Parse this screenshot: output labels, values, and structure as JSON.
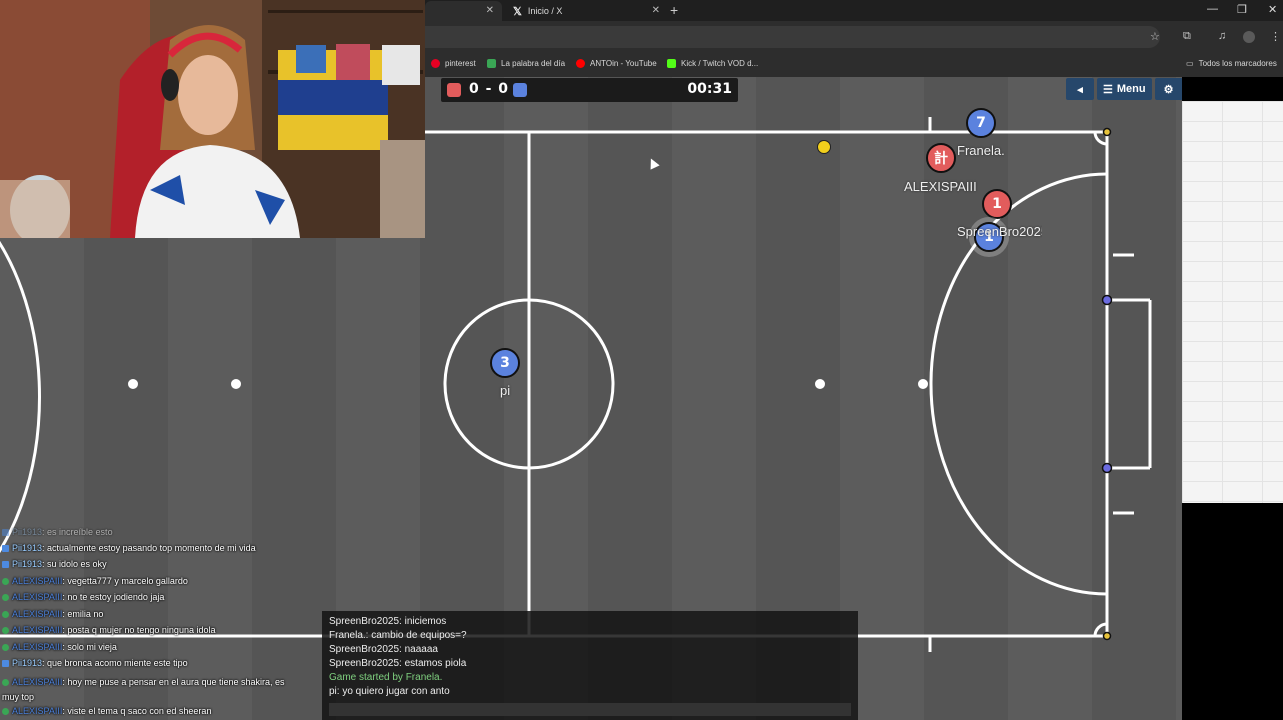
{
  "browser": {
    "tabs": [
      {
        "title": ""
      },
      {
        "title": "Inicio / X",
        "icon": "x-logo"
      }
    ],
    "new_tab": "+",
    "window_controls": {
      "minimize": "—",
      "restore": "❐",
      "close": "✕"
    },
    "toolbar_icons": [
      "star-icon",
      "extensions-icon",
      "media-icon",
      "profile-icon",
      "menu-icon"
    ],
    "bookmarks": [
      {
        "label": "pinterest",
        "color": "#e60023"
      },
      {
        "label": "La palabra del día",
        "color": "#3aa655"
      },
      {
        "label": "ANTOin - YouTube",
        "color": "#ff0000"
      },
      {
        "label": "Kick / Twitch VOD d...",
        "color": "#53fc18"
      }
    ],
    "all_bookmarks": "Todos los marcadores"
  },
  "game": {
    "score": "0 - 0",
    "timer": "00:31",
    "menu_label": "Menu",
    "red_color": "#e25c5c",
    "blue_color": "#5b82de",
    "players": {
      "p1_avatar": "7",
      "p1_name": "Franela.",
      "p2_avatar": "計",
      "p2_name": "ALEXISPAIII",
      "p3_avatar": "1",
      "p4_avatar": "1",
      "p4_name": "SpreenBro2025",
      "p5_avatar": "3",
      "p5_name": "pi"
    }
  },
  "game_chat": [
    {
      "text": "SpreenBro2025: iniciemos"
    },
    {
      "text": "Franela.: cambio de equipos=?"
    },
    {
      "text": "SpreenBro2025: naaaaa"
    },
    {
      "text": "SpreenBro2025: estamos piola"
    },
    {
      "text": "Game started by Franela.",
      "system": true
    },
    {
      "text": "pi: yo quiero jugar con anto"
    }
  ],
  "stream_chat": [
    {
      "user": "Pii1913",
      "msg": ": es increíble esto"
    },
    {
      "user": "Pii1913",
      "msg": ": actualmente estoy pasando top momento de mi vida"
    },
    {
      "user": "Pii1913",
      "msg": ": su idolo es oky"
    },
    {
      "user": "ALEXISPAIII",
      "msg": ": vegetta777 y marcelo gallardo"
    },
    {
      "user": "ALEXISPAIII",
      "msg": ": no te estoy jodiendo jaja"
    },
    {
      "user": "ALEXISPAIII",
      "msg": ": emilia no"
    },
    {
      "user": "ALEXISPAIII",
      "msg": ": posta q mujer no tengo ninguna idola"
    },
    {
      "user": "ALEXISPAIII",
      "msg": ": solo mi vieja"
    },
    {
      "user": "Pii1913",
      "msg": ": que bronca acomo miente este tipo"
    },
    {
      "user": "ALEXISPAIII",
      "msg": ": hoy me puse a pensar en el aura que tiene shakira, es muy top"
    },
    {
      "user": "ALEXISPAIII",
      "msg": ": viste el tema q saco con ed sheeran"
    }
  ]
}
